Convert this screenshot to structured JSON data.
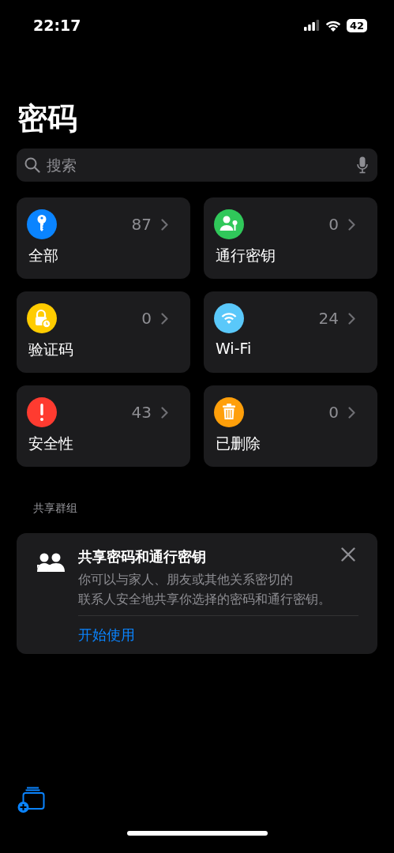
{
  "status_bar": {
    "time": "22:17",
    "battery": "42"
  },
  "title": "密码",
  "search": {
    "placeholder": "搜索"
  },
  "categories": [
    {
      "label": "全部",
      "count": "87",
      "kind": "key",
      "color": "#0a84ff"
    },
    {
      "label": "通行密钥",
      "count": "0",
      "kind": "passkey",
      "color": "#30c85a"
    },
    {
      "label": "验证码",
      "count": "0",
      "kind": "lock-clock",
      "color": "#ffcc00"
    },
    {
      "label": "Wi-Fi",
      "count": "24",
      "kind": "wifi",
      "color": "#5ac8fa"
    },
    {
      "label": "安全性",
      "count": "43",
      "kind": "alert",
      "color": "#ff3b30"
    },
    {
      "label": "已删除",
      "count": "0",
      "kind": "trash",
      "color": "#ff9f0a"
    }
  ],
  "shared_groups": {
    "heading": "共享群组",
    "card": {
      "title": "共享密码和通行密钥",
      "description_lines": [
        "你可以与家人、朋友或其他关系密切的",
        "联系人安全地共享你选择的密码和通行密钥。"
      ],
      "action": "开始使用"
    }
  }
}
